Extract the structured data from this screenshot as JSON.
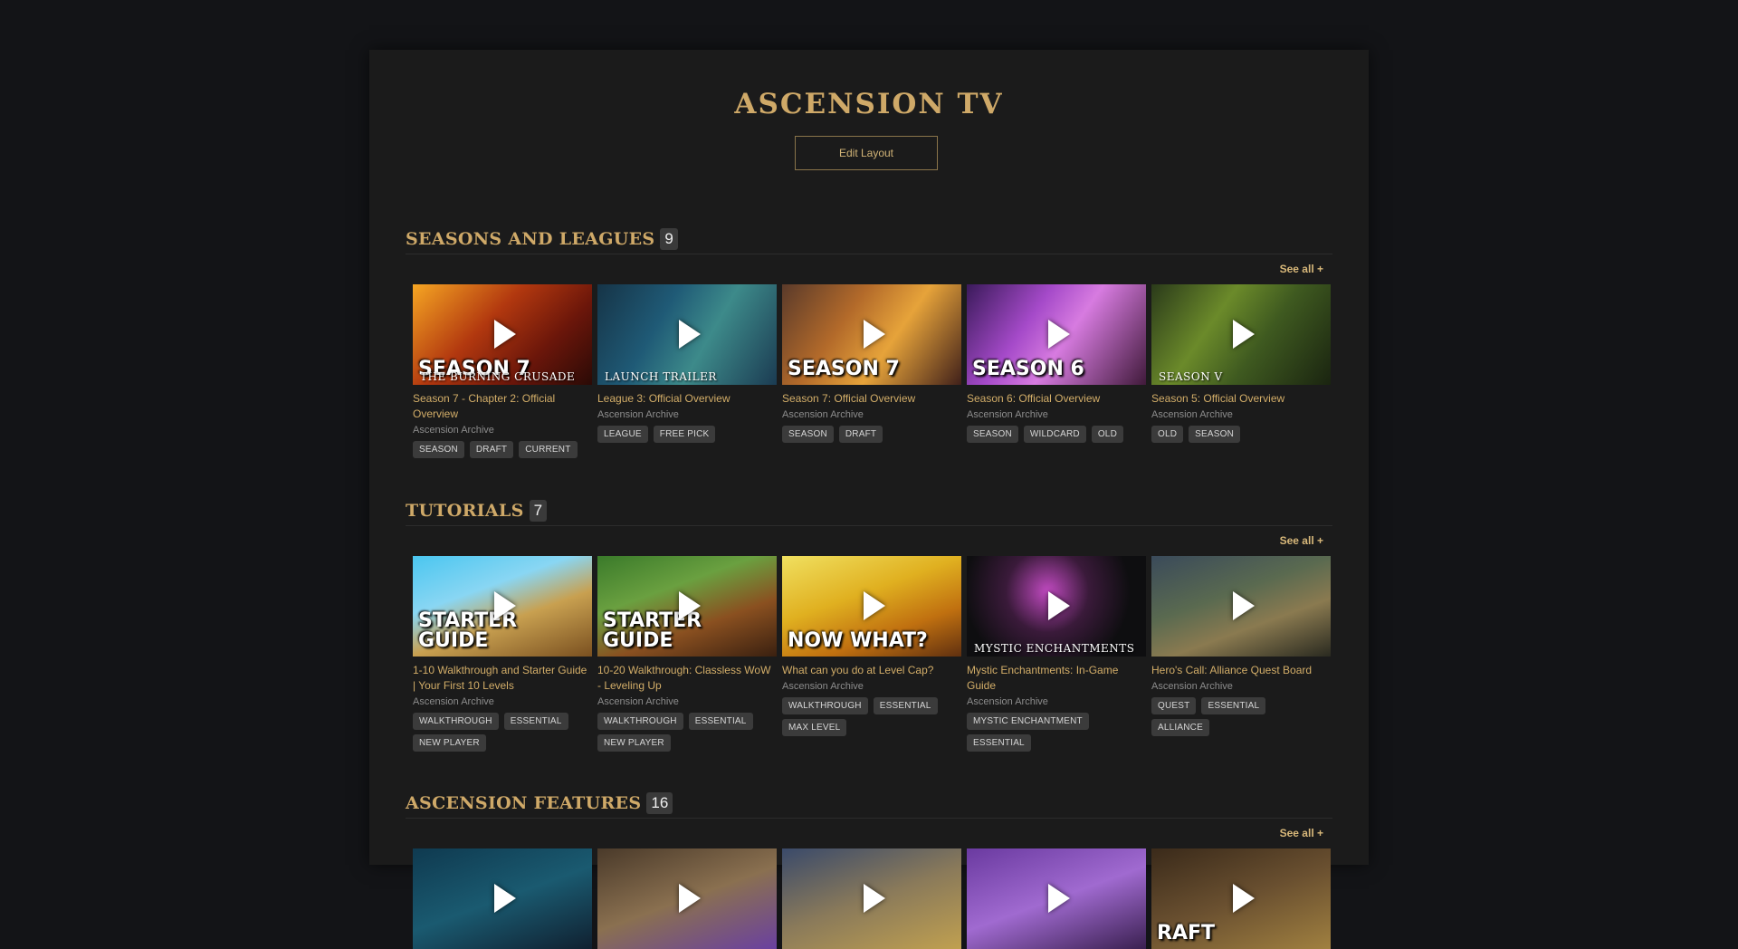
{
  "site_title": "ASCENSION TV",
  "edit_layout_label": "Edit Layout",
  "sections": [
    {
      "title": "SEASONS AND LEAGUES",
      "count": "9",
      "see_all": "See all +",
      "cards": [
        {
          "title": "Season 7 - Chapter 2: Official Overview",
          "channel": "Ascension Archive",
          "tags": [
            "SEASON",
            "DRAFT",
            "CURRENT"
          ],
          "thumb_text": "SEASON 7",
          "thumb_sub": "THE BURNING CRUSADE"
        },
        {
          "title": "League 3: Official Overview",
          "channel": "Ascension Archive",
          "tags": [
            "LEAGUE",
            "FREE PICK"
          ],
          "thumb_text": "",
          "thumb_sub": "LAUNCH TRAILER"
        },
        {
          "title": "Season 7: Official Overview",
          "channel": "Ascension Archive",
          "tags": [
            "SEASON",
            "DRAFT"
          ],
          "thumb_text": "SEASON 7",
          "thumb_sub": ""
        },
        {
          "title": "Season 6: Official Overview",
          "channel": "Ascension Archive",
          "tags": [
            "SEASON",
            "WILDCARD",
            "OLD"
          ],
          "thumb_text": "SEASON 6",
          "thumb_sub": ""
        },
        {
          "title": "Season 5: Official Overview",
          "channel": "Ascension Archive",
          "tags": [
            "OLD",
            "SEASON"
          ],
          "thumb_text": "",
          "thumb_sub": "SEASON V"
        }
      ]
    },
    {
      "title": "TUTORIALS",
      "count": "7",
      "see_all": "See all +",
      "cards": [
        {
          "title": "1-10 Walkthrough and Starter Guide | Your First 10 Levels",
          "channel": "Ascension Archive",
          "tags": [
            "WALKTHROUGH",
            "ESSENTIAL",
            "NEW PLAYER"
          ],
          "thumb_text": "STARTER GUIDE",
          "thumb_sub": ""
        },
        {
          "title": "10-20 Walkthrough: Classless WoW - Leveling Up",
          "channel": "Ascension Archive",
          "tags": [
            "WALKTHROUGH",
            "ESSENTIAL",
            "NEW PLAYER"
          ],
          "thumb_text": "STARTER GUIDE",
          "thumb_sub": ""
        },
        {
          "title": "What can you do at Level Cap?",
          "channel": "Ascension Archive",
          "tags": [
            "WALKTHROUGH",
            "ESSENTIAL",
            "MAX LEVEL"
          ],
          "thumb_text": "NOW WHAT?",
          "thumb_sub": ""
        },
        {
          "title": "Mystic Enchantments: In-Game Guide",
          "channel": "Ascension Archive",
          "tags": [
            "MYSTIC ENCHANTMENT",
            "ESSENTIAL"
          ],
          "thumb_text": "",
          "thumb_sub": "MYSTIC ENCHANTMENTS"
        },
        {
          "title": "Hero's Call: Alliance Quest Board",
          "channel": "Ascension Archive",
          "tags": [
            "QUEST",
            "ESSENTIAL",
            "ALLIANCE"
          ],
          "thumb_text": "",
          "thumb_sub": ""
        }
      ]
    },
    {
      "title": "ASCENSION FEATURES",
      "count": "16",
      "see_all": "See all +",
      "cards": [
        {
          "title": "",
          "channel": "",
          "tags": [],
          "thumb_text": "",
          "thumb_sub": ""
        },
        {
          "title": "",
          "channel": "",
          "tags": [],
          "thumb_text": "",
          "thumb_sub": ""
        },
        {
          "title": "",
          "channel": "",
          "tags": [],
          "thumb_text": "",
          "thumb_sub": ""
        },
        {
          "title": "",
          "channel": "",
          "tags": [],
          "thumb_text": "",
          "thumb_sub": ""
        },
        {
          "title": "",
          "channel": "",
          "tags": [],
          "thumb_text": "RAFT",
          "thumb_sub": ""
        }
      ]
    }
  ],
  "icons": {
    "play": "play-icon"
  }
}
